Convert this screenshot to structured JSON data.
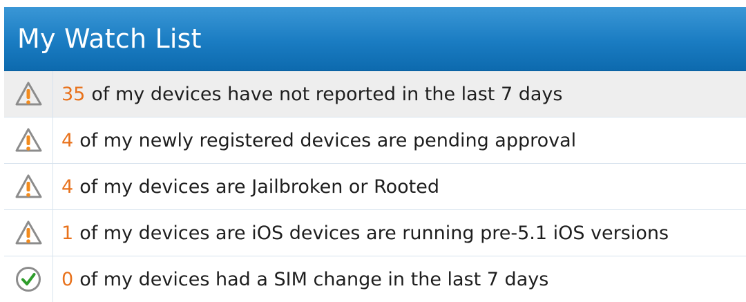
{
  "header": {
    "title": "My Watch List"
  },
  "colors": {
    "header_top": "#3a97d6",
    "header_bottom": "#0d6aae",
    "count": "#e8721c",
    "warning_orange": "#f28b1d",
    "ok_green": "#2e9d2b"
  },
  "items": [
    {
      "icon": "warning-icon",
      "count": "35",
      "text": "of my devices have not reported in the last 7 days"
    },
    {
      "icon": "warning-icon",
      "count": "4",
      "text": "of my newly registered devices are pending approval"
    },
    {
      "icon": "warning-icon",
      "count": "4",
      "text": "of my devices are Jailbroken or Rooted"
    },
    {
      "icon": "warning-icon",
      "count": "1",
      "text": "of my devices are iOS devices are running pre-5.1 iOS versions"
    },
    {
      "icon": "check-circle-icon",
      "count": "0",
      "text": "of my devices had a SIM change in the last 7 days"
    }
  ]
}
